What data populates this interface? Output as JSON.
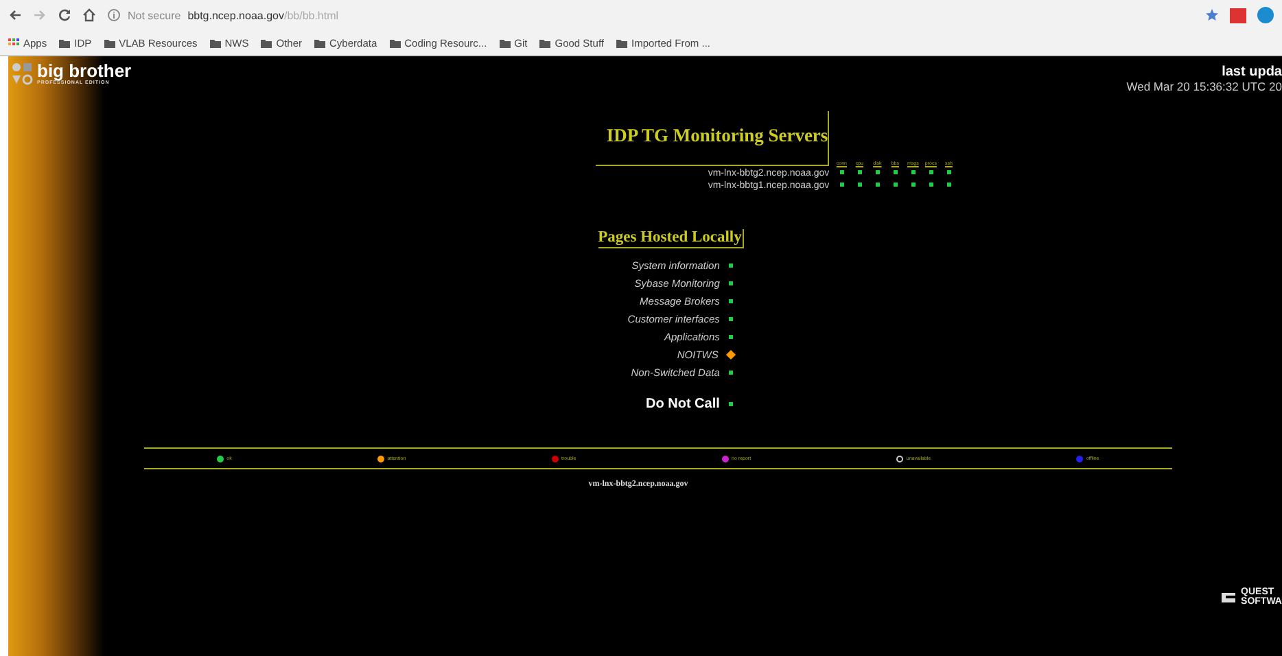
{
  "browser": {
    "security": "Not secure",
    "url_host": "bbtg.ncep.noaa.gov",
    "url_path": "/bb/bb.html",
    "bookmarks": [
      {
        "label": "Apps",
        "kind": "apps"
      },
      {
        "label": "IDP",
        "kind": "folder"
      },
      {
        "label": "VLAB Resources",
        "kind": "folder"
      },
      {
        "label": "NWS",
        "kind": "folder"
      },
      {
        "label": "Other",
        "kind": "folder"
      },
      {
        "label": "Cyberdata",
        "kind": "folder"
      },
      {
        "label": "Coding Resourc...",
        "kind": "folder"
      },
      {
        "label": "Git",
        "kind": "folder"
      },
      {
        "label": "Good Stuff",
        "kind": "folder"
      },
      {
        "label": "Imported From ...",
        "kind": "folder"
      }
    ]
  },
  "header": {
    "logo": "big brother",
    "logo_sub": "PROFESSIONAL EDITION",
    "update_label": "last upda",
    "update_time": "Wed Mar 20 15:36:32 UTC 20"
  },
  "servers": {
    "title": "IDP TG Monitoring Servers",
    "columns": [
      "conn",
      "cpu",
      "disk",
      "bbs",
      "msgs",
      "procs",
      "ssh"
    ],
    "rows": [
      {
        "host": "vm-lnx-bbtg2.ncep.noaa.gov",
        "statuses": [
          {
            "color": "#22cc44"
          },
          {
            "color": "#22cc44"
          },
          {
            "color": "#22cc44"
          },
          {
            "color": "#22cc44"
          },
          {
            "color": "#22cc44"
          },
          {
            "color": "#22cc44"
          },
          {
            "color": "#22cc44"
          }
        ]
      },
      {
        "host": "vm-lnx-bbtg1.ncep.noaa.gov",
        "statuses": [
          {
            "color": "#22cc44"
          },
          {
            "color": "#22cc44"
          },
          {
            "color": "#22cc44"
          },
          {
            "color": "#22cc44"
          },
          {
            "color": "#22cc44"
          },
          {
            "color": "#22cc44"
          },
          {
            "color": "#22cc44"
          }
        ]
      }
    ]
  },
  "pages": {
    "title": "Pages Hosted Locally",
    "items": [
      {
        "label": "System information",
        "color": "#22cc44",
        "kind": "italic"
      },
      {
        "label": "Sybase Monitoring",
        "color": "#22cc44",
        "kind": "italic"
      },
      {
        "label": "Message Brokers",
        "color": "#22cc44",
        "kind": "italic"
      },
      {
        "label": "Customer interfaces",
        "color": "#22cc44",
        "kind": "italic"
      },
      {
        "label": "Applications",
        "color": "#22cc44",
        "kind": "italic"
      },
      {
        "label": "NOITWS",
        "color": "#ff9900",
        "kind": "italic"
      },
      {
        "label": "Non-Switched Data",
        "color": "#22cc44",
        "kind": "italic"
      },
      {
        "label": "Do Not Call",
        "color": "#22cc44",
        "kind": "bold"
      }
    ]
  },
  "legend": [
    {
      "label": "ok",
      "color": "#22cc44",
      "kind": "filled"
    },
    {
      "label": "attention",
      "color": "#ff9900",
      "kind": "filled"
    },
    {
      "label": "trouble",
      "color": "#cc0000",
      "kind": "filled"
    },
    {
      "label": "no report",
      "color": "#cc22cc",
      "kind": "filled"
    },
    {
      "label": "unavailable",
      "color": "#cccccc",
      "kind": "hollow"
    },
    {
      "label": "offline",
      "color": "#2222ee",
      "kind": "filled"
    }
  ],
  "footer": {
    "host": "vm-lnx-bbtg2.ncep.noaa.gov"
  },
  "vendor": {
    "name": "QUEST",
    "sub": "SOFTWA"
  }
}
